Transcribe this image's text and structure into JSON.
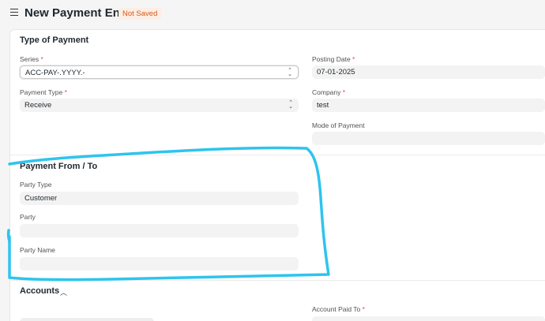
{
  "header": {
    "title": "New Payment Entry",
    "status_badge": "Not Saved"
  },
  "type_of_payment": {
    "section_title": "Type of Payment",
    "series": {
      "label": "Series",
      "value": "ACC-PAY-.YYYY.-"
    },
    "payment_type": {
      "label": "Payment Type",
      "value": "Receive"
    },
    "posting_date": {
      "label": "Posting Date",
      "value": "07-01-2025"
    },
    "company": {
      "label": "Company",
      "value": "test"
    },
    "mode_of_payment": {
      "label": "Mode of Payment",
      "value": ""
    }
  },
  "payment_from_to": {
    "section_title": "Payment From / To",
    "party_type": {
      "label": "Party Type",
      "value": "Customer"
    },
    "party": {
      "label": "Party",
      "value": ""
    },
    "party_name": {
      "label": "Party Name",
      "value": ""
    }
  },
  "accounts": {
    "section_title": "Accounts",
    "account_paid_to": {
      "label": "Account Paid To"
    }
  },
  "required_marker": "*",
  "colors": {
    "highlight": "#2ec4ee",
    "required": "#e24c4c",
    "badge_text": "#d45a1a"
  }
}
